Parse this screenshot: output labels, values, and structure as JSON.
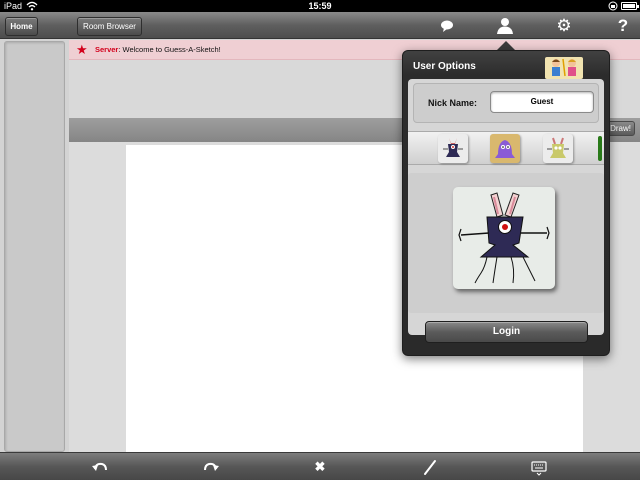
{
  "status_bar": {
    "carrier": "iPad",
    "time": "15:59"
  },
  "toolbar": {
    "home_label": "Home",
    "room_browser_label": "Room Browser",
    "icons": [
      "chat-icon",
      "user-icon",
      "gear-icon",
      "help-icon"
    ]
  },
  "messages": {
    "server_label": "Server",
    "server_text": ": Welcome to Guess-A-Sketch!"
  },
  "canvas": {
    "draw_button_label": "Draw!"
  },
  "user_options": {
    "title": "User Options",
    "nick_name_label": "Nick Name:",
    "nick_name_value": "Guest",
    "avatars": [
      "purple-bunny-monster",
      "purple-blob-monster",
      "green-bunny-monster"
    ],
    "login_label": "Login"
  },
  "bottom_bar": {
    "icons": [
      "undo-icon",
      "redo-icon",
      "clear-icon",
      "pen-icon",
      "keyboard-icon"
    ]
  },
  "colors": {
    "server_label": "#d3001c",
    "server_bar_bg": "#efcfd3",
    "popover_bg": "#2c2c2c"
  }
}
